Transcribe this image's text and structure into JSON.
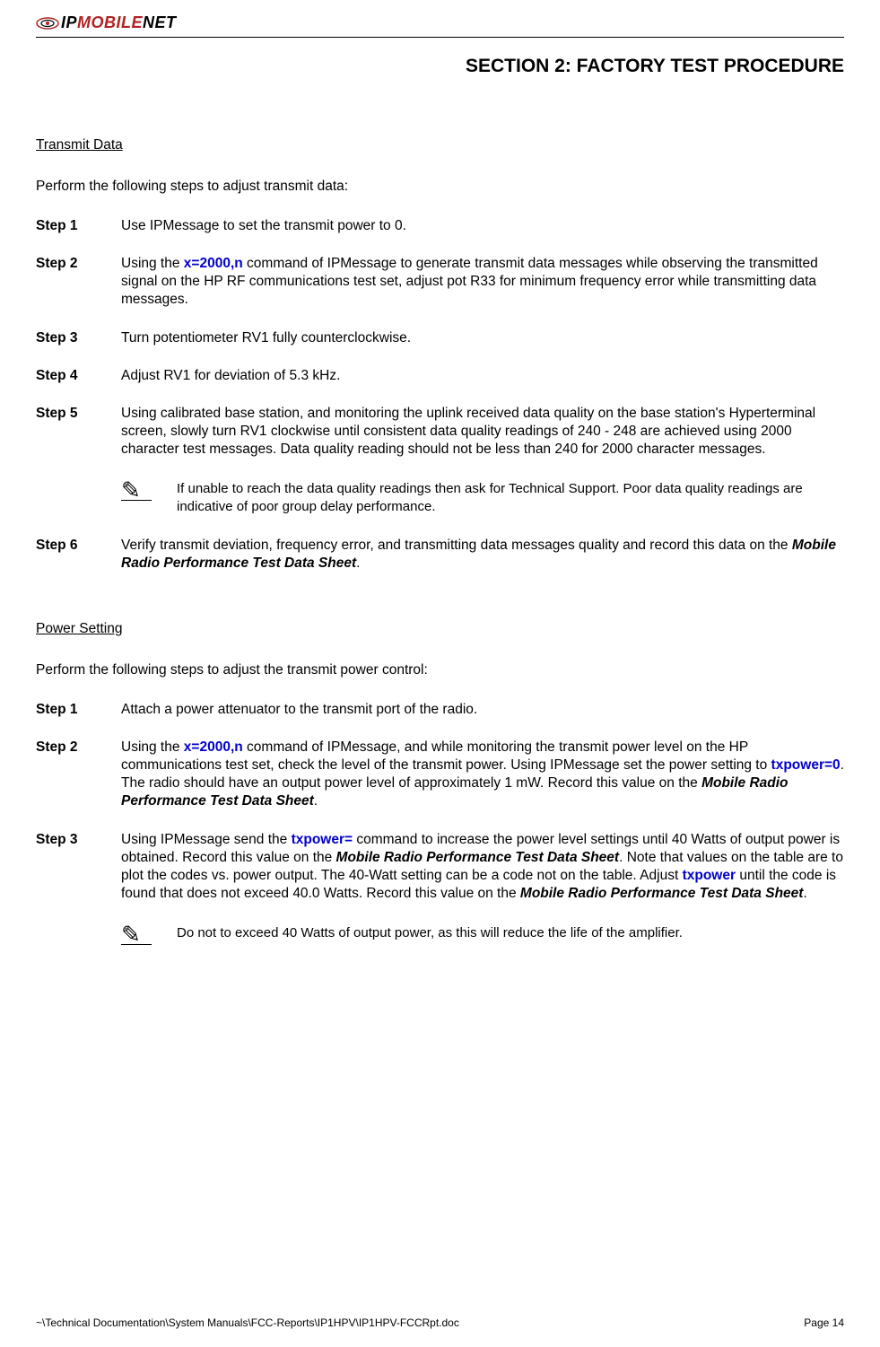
{
  "header": {
    "logo_ip": "IP",
    "logo_mobile": "MOBILE",
    "logo_net": "NET",
    "section_title": "SECTION 2:  FACTORY TEST PROCEDURE"
  },
  "transmit": {
    "heading": "Transmit Data",
    "intro": "Perform the following steps to adjust transmit data:",
    "step1_label": "Step 1",
    "step1_text": "Use IPMessage to set the transmit power to 0.",
    "step2_label": "Step 2",
    "step2_a": "Using the ",
    "step2_cmd": "x=2000,n",
    "step2_b": " command of IPMessage to generate transmit data messages while observing the transmitted signal on the HP RF communications test set, adjust pot R33 for minimum frequency error while transmitting data messages.",
    "step3_label": "Step 3",
    "step3_text": "Turn potentiometer RV1 fully counterclockwise.",
    "step4_label": "Step 4",
    "step4_text": "Adjust RV1 for deviation of 5.3 kHz.",
    "step5_label": "Step 5",
    "step5_text": "Using calibrated base station, and monitoring the uplink received data quality on the base station's Hyperterminal screen, slowly turn RV1 clockwise until consistent data quality readings of 240 - 248 are achieved using 2000 character test messages.  Data quality reading should not be less than 240 for 2000 character messages.",
    "note1": "If unable to reach the data quality readings then ask for Technical Support.   Poor data quality readings are indicative of poor group delay performance.",
    "step6_label": "Step 6",
    "step6_a": "Verify transmit deviation, frequency error, and transmitting data messages quality and record this data on the ",
    "step6_bi": "Mobile Radio Performance Test Data Sheet",
    "step6_b": "."
  },
  "power": {
    "heading": "Power Setting",
    "intro": "Perform the following steps to adjust the transmit power control:",
    "step1_label": "Step 1",
    "step1_text": "Attach a power attenuator to the transmit port of the radio.",
    "step2_label": "Step 2",
    "step2_a": "Using the ",
    "step2_cmd1": "x=2000,n",
    "step2_b": " command of IPMessage, and while monitoring the transmit power level on the HP communications test set, check the level of the transmit power.  Using IPMessage set the power setting to ",
    "step2_cmd2": "txpower=0",
    "step2_c": ".  The radio should have an output power level of approximately 1 mW.  Record this value on the ",
    "step2_bi": "Mobile Radio Performance Test Data Sheet",
    "step2_d": ".",
    "step3_label": "Step 3",
    "step3_a": "Using IPMessage send the ",
    "step3_cmd1": "txpower=",
    "step3_b": " command to increase the power level settings until 40 Watts of output power is obtained.  Record this value on the ",
    "step3_bi1": "Mobile Radio Performance Test Data Sheet",
    "step3_c": ".  Note that values on the table are to plot the codes vs. power output.  The 40-Watt setting can be a code not on the table. Adjust ",
    "step3_cmd2": "txpower",
    "step3_d": " until the code is found that does not exceed 40.0 Watts.  Record this value on the ",
    "step3_bi2": "Mobile Radio Performance Test Data Sheet",
    "step3_e": ".",
    "note2": "Do not to exceed 40 Watts of output power, as this will reduce the life of the amplifier."
  },
  "footer": {
    "path": "~\\Technical Documentation\\System Manuals\\FCC-Reports\\IP1HPV\\IP1HPV-FCCRpt.doc",
    "page": "Page 14"
  }
}
